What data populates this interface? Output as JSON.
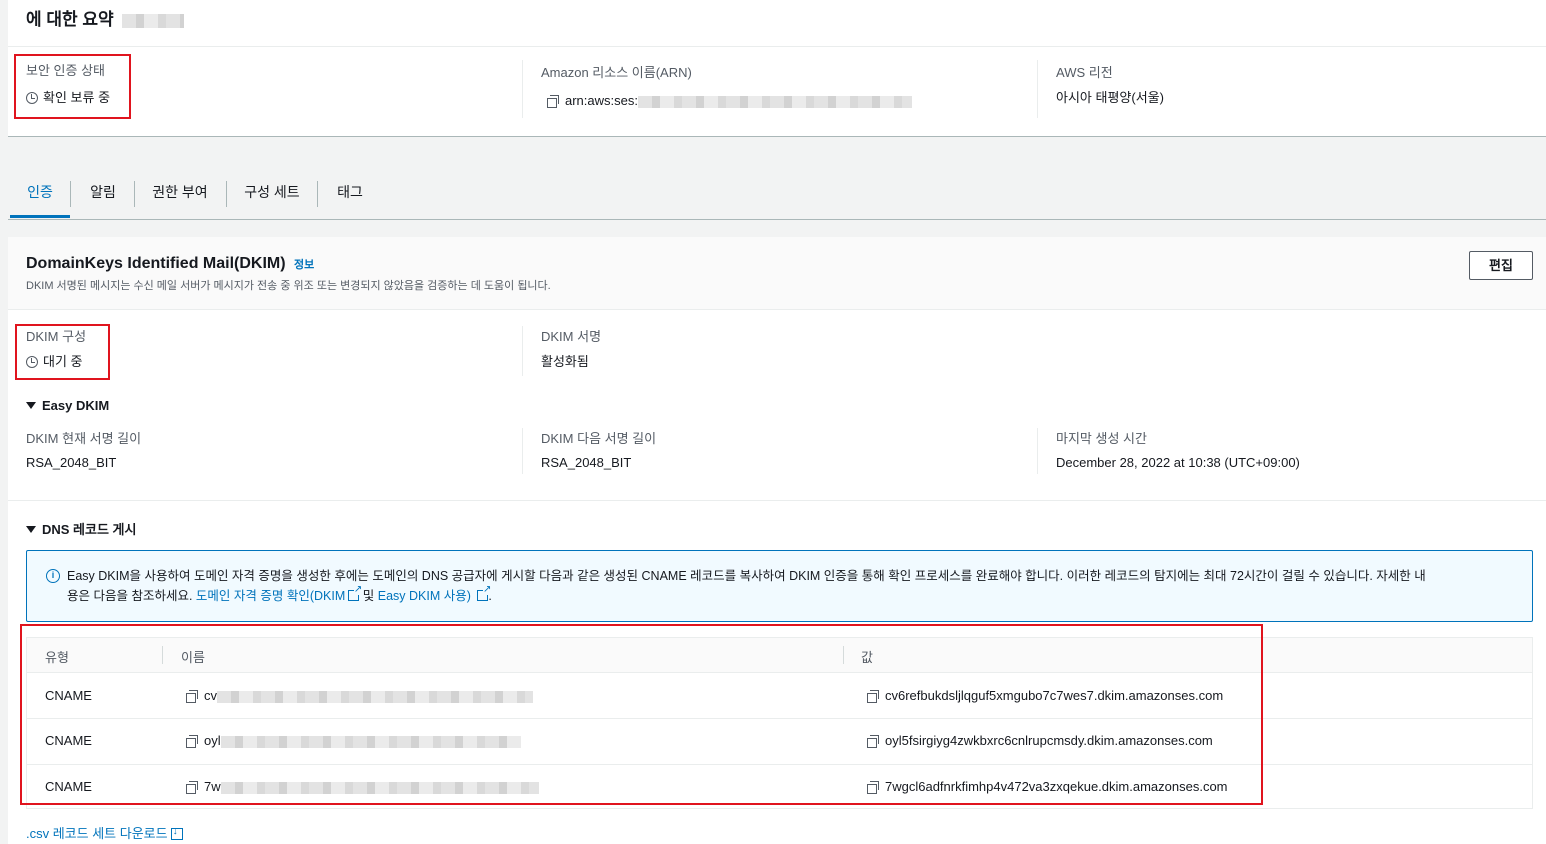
{
  "summary": {
    "title": "에 대한 요약",
    "security_status_label": "보안 인증 상태",
    "security_status_value": "확인 보류 중",
    "arn_label": "Amazon 리소스 이름(ARN)",
    "arn_prefix": "arn:aws:ses:",
    "region_label": "AWS 리전",
    "region_value": "아시아 태평양(서울)"
  },
  "tabs": [
    "인증",
    "알림",
    "권한 부여",
    "구성 세트",
    "태그"
  ],
  "dkim": {
    "title": "DomainKeys Identified Mail(DKIM)",
    "info_link": "정보",
    "description": "DKIM 서명된 메시지는 수신 메일 서버가 메시지가 전송 중 위조 또는 변경되지 않았음을 검증하는 데 도움이 됩니다.",
    "edit_button": "편집",
    "config_label": "DKIM 구성",
    "config_value": "대기 중",
    "signing_label": "DKIM 서명",
    "signing_value": "활성화됨",
    "easy_dkim_header": "Easy DKIM",
    "current_length_label": "DKIM 현재 서명 길이",
    "current_length_value": "RSA_2048_BIT",
    "next_length_label": "DKIM 다음 서명 길이",
    "next_length_value": "RSA_2048_BIT",
    "last_generated_label": "마지막 생성 시간",
    "last_generated_value": "December 28, 2022 at 10:38 (UTC+09:00)"
  },
  "dns": {
    "header": "DNS 레코드 게시",
    "info_text_1": "Easy DKIM을 사용하여 도메인 자격 증명을 생성한 후에는 도메인의 DNS 공급자에 게시할 다음과 같은 생성된 CNAME 레코드를 복사하여 DKIM 인증을 통해 확인 프로세스를 완료해야 합니다. 이러한 레코드의 탐지에는 최대 72시간이 걸릴 수 있습니다. 자세한 내",
    "info_text_2": "용은 다음을 참조하세요.",
    "info_link_1": "도메인 자격 증명 확인(DKIM",
    "info_and": "및",
    "info_link_2": "Easy DKIM 사용)",
    "info_period": ".",
    "columns": [
      "유형",
      "이름",
      "값"
    ],
    "rows": [
      {
        "type": "CNAME",
        "name_prefix": "cv",
        "value": "cv6refbukdsljlqguf5xmgubo7c7wes7.dkim.amazonses.com"
      },
      {
        "type": "CNAME",
        "name_prefix": "oyl",
        "value": "oyl5fsirgiyg4zwkbxrc6cnlrupcmsdy.dkim.amazonses.com"
      },
      {
        "type": "CNAME",
        "name_prefix": "7w",
        "value": "7wgcl6adfnrkfimhp4v472va3zxqekue.dkim.amazonses.com"
      }
    ],
    "download_link": ".csv 레코드 세트 다운로드"
  }
}
